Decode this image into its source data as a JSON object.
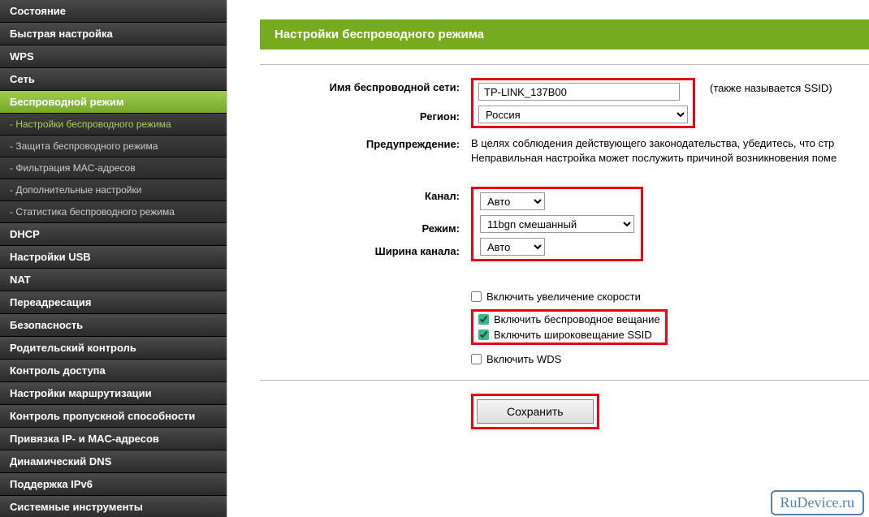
{
  "sidebar": {
    "items": [
      {
        "label": "Состояние"
      },
      {
        "label": "Быстрая настройка"
      },
      {
        "label": "WPS"
      },
      {
        "label": "Сеть"
      },
      {
        "label": "Беспроводной режим",
        "active": true
      },
      {
        "label": "DHCP"
      },
      {
        "label": "Настройки USB"
      },
      {
        "label": "NAT"
      },
      {
        "label": "Переадресация"
      },
      {
        "label": "Безопасность"
      },
      {
        "label": "Родительский контроль"
      },
      {
        "label": "Контроль доступа"
      },
      {
        "label": "Настройки маршрутизации"
      },
      {
        "label": "Контроль пропускной способности"
      },
      {
        "label": "Привязка IP- и MAC-адресов"
      },
      {
        "label": "Динамический DNS"
      },
      {
        "label": "Поддержка IPv6"
      },
      {
        "label": "Системные инструменты"
      }
    ],
    "subitems": [
      {
        "label": "- Настройки беспроводного режима",
        "active": true
      },
      {
        "label": "- Защита беспроводного режима"
      },
      {
        "label": "- Фильтрация MAC-адресов"
      },
      {
        "label": "- Дополнительные настройки"
      },
      {
        "label": "- Статистика беспроводного режима"
      }
    ]
  },
  "page": {
    "title": "Настройки беспроводного режима",
    "labels": {
      "ssid": "Имя беспроводной сети:",
      "region": "Регион:",
      "warning": "Предупреждение:",
      "channel": "Канал:",
      "mode": "Режим:",
      "width": "Ширина канала:"
    },
    "fields": {
      "ssid": "TP-LINK_137B00",
      "region": "Россия",
      "warn_text": "В целях соблюдения действующего законодательства, убедитесь, что стр\nНеправильная настройка может послужить причиной возникновения поме",
      "channel": "Авто",
      "mode": "11bgn смешанный",
      "width": "Авто"
    },
    "ssid_note": "(также называется SSID)",
    "checkboxes": {
      "speed": "Включить увеличение скорости",
      "radio": "Включить беспроводное вещание",
      "ssid_broadcast": "Включить широковещание SSID",
      "wds": "Включить WDS"
    },
    "save": "Сохранить"
  },
  "watermark": "RuDevice.ru"
}
